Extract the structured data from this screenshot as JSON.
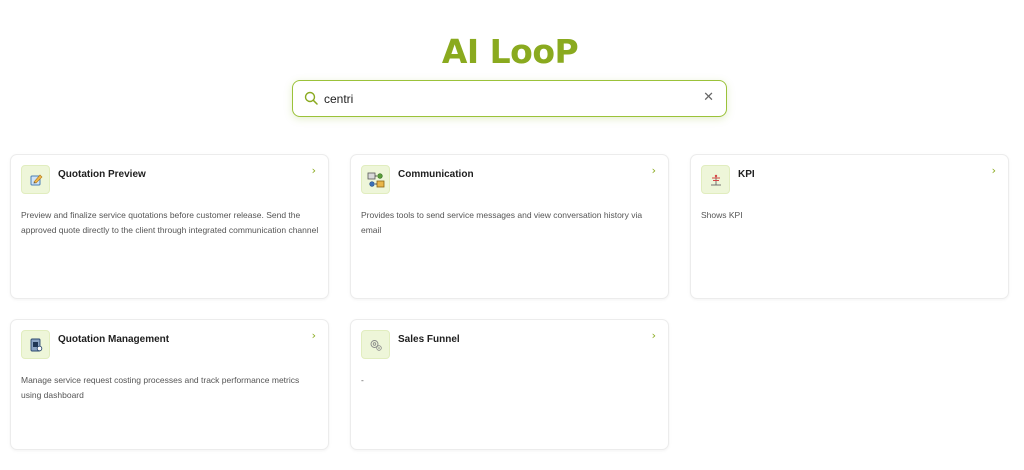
{
  "brand": {
    "logo_text": "AI LooP",
    "accent_color": "#8aaa1f"
  },
  "search": {
    "value": "centri",
    "placeholder": ""
  },
  "chevron": "›",
  "cards": [
    {
      "title": "Quotation Preview",
      "description": "Preview and finalize service quotations before customer release. Send the approved quote directly to the client through integrated communication channel",
      "icon": "quotation-preview-icon"
    },
    {
      "title": "Communication",
      "description": "Provides tools to send service messages and view conversation history via email",
      "icon": "communication-icon"
    },
    {
      "title": "KPI",
      "description": "Shows KPI",
      "icon": "kpi-icon"
    },
    {
      "title": "Quotation Management",
      "description": "Manage service request costing processes and track performance metrics using dashboard",
      "icon": "quotation-management-icon"
    },
    {
      "title": "Sales Funnel",
      "description": "-",
      "icon": "sales-funnel-icon"
    }
  ]
}
